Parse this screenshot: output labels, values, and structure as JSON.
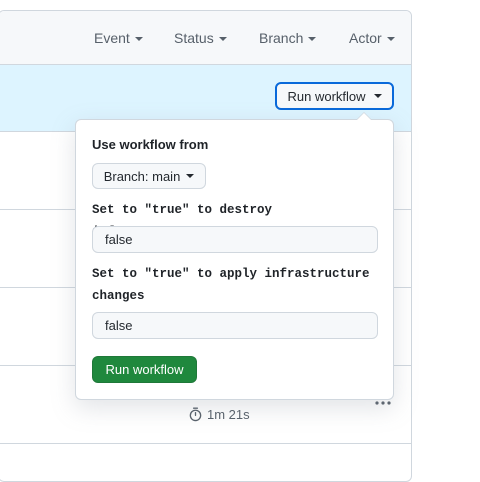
{
  "filters": [
    {
      "label": "Event"
    },
    {
      "label": "Status"
    },
    {
      "label": "Branch"
    },
    {
      "label": "Actor"
    }
  ],
  "banner": {
    "run_button_label": "Run workflow"
  },
  "dispatch": {
    "heading": "Use workflow from",
    "branch_label": "Branch: main",
    "inputs": [
      {
        "label": "Set to \"true\" to destroy infrastructure",
        "value": "false"
      },
      {
        "label": "Set to \"true\" to apply infrastructure changes",
        "value": "false"
      }
    ],
    "submit_label": "Run workflow",
    "submit_color": "#1f883d"
  },
  "run_row": {
    "duration": "1m 21s",
    "duration_icon": "stopwatch-icon",
    "menu_icon": "kebab-horizontal-icon"
  },
  "colors": {
    "accent": "#0969da",
    "banner_bg": "#ddf4ff",
    "success": "#1f883d"
  }
}
